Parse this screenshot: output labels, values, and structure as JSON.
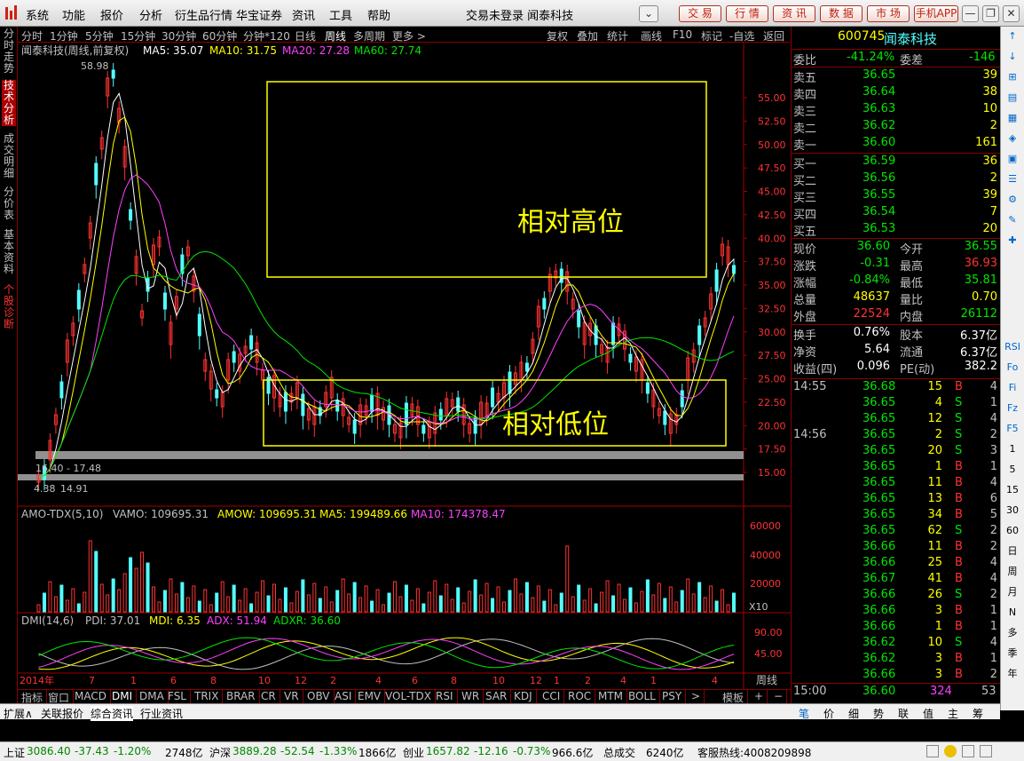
{
  "menu": {
    "items": [
      "系统",
      "功能",
      "报价",
      "分析",
      "衍生品行情",
      "华宝证券",
      "资讯",
      "工具",
      "帮助"
    ],
    "title": "交易未登录  闻泰科技",
    "buttons": [
      "交 易",
      "行 情",
      "资 讯",
      "数 据",
      "市 场",
      "手机APP"
    ]
  },
  "periods": {
    "items": [
      "分时",
      "1分钟",
      "5分钟",
      "15分钟",
      "30分钟",
      "60分钟",
      "分钟*120",
      "日线",
      "周线",
      "多周期",
      "更多 >"
    ],
    "right": [
      "复权",
      "叠加",
      "统计",
      "画线",
      "F10",
      "标记",
      "-自选",
      "返回"
    ]
  },
  "left_tabs": [
    "分时走势",
    "技术分析",
    "成交明细",
    "分价表",
    "基本资料",
    "个股诊断"
  ],
  "chart": {
    "stock_label": "闻泰科技(周线,前复权)",
    "ma": [
      {
        "label": "MA5: 35.07",
        "color": "#ffffff"
      },
      {
        "label": "MA10: 31.75",
        "color": "#ffff00"
      },
      {
        "label": "MA20: 27.28",
        "color": "#ff40ff"
      },
      {
        "label": "MA60: 27.74",
        "color": "#00e600"
      }
    ],
    "price_ticks": [
      "55.00",
      "52.50",
      "50.00",
      "47.50",
      "45.00",
      "42.50",
      "40.00",
      "37.50",
      "35.00",
      "32.50",
      "30.00",
      "27.50",
      "25.00",
      "22.50",
      "20.00",
      "17.50",
      "15.00"
    ],
    "high_label": "58.98",
    "low_label": "4.38",
    "low2": "14.91",
    "range_label": "16.40 - 17.48",
    "box_high": "相对高位",
    "box_low": "相对低位",
    "vol_label": "AMO-TDX(5,10)",
    "vol_items": [
      {
        "t": "VAMO: 109695.31",
        "c": "#c0c0c0"
      },
      {
        "t": "AMOW: 109695.31",
        "c": "#ffff00"
      },
      {
        "t": "MA5: 199489.66",
        "c": "#ffff00"
      },
      {
        "t": "MA10: 174378.47",
        "c": "#ff40ff"
      }
    ],
    "vol_ticks": [
      "60000",
      "40000",
      "20000"
    ],
    "vol_unit": "X10",
    "dmi_label": "DMI(14,6)",
    "dmi_items": [
      {
        "t": "PDI: 37.01",
        "c": "#c0c0c0"
      },
      {
        "t": "MDI: 6.35",
        "c": "#ffff00"
      },
      {
        "t": "ADX: 51.94",
        "c": "#ff40ff"
      },
      {
        "t": "ADXR: 36.60",
        "c": "#00e600"
      }
    ],
    "dmi_ticks": [
      "90.00",
      "45.00"
    ],
    "x_labels": [
      "2014年",
      "7",
      "1",
      "6",
      "8",
      "10",
      "12",
      "2",
      "4",
      "6",
      "8",
      "10",
      "12",
      "1",
      "2",
      "4",
      "1",
      "4"
    ],
    "period_label": "周线"
  },
  "bottom_tabs": [
    "指标",
    "窗口",
    "MACD",
    "DMI",
    "DMA",
    "FSL",
    "TRIX",
    "BRAR",
    "CR",
    "VR",
    "OBV",
    "ASI",
    "EMV",
    "VOL-TDX",
    "RSI",
    "WR",
    "SAR",
    "KDJ",
    "CCI",
    "ROC",
    "MTM",
    "BOLL",
    "PSY",
    ">",
    "模板",
    "+",
    "−"
  ],
  "info_tabs": [
    "扩展∧",
    "关联报价",
    "综合资讯",
    "行业资讯"
  ],
  "quote": {
    "code": "600745",
    "name": "闻泰科技",
    "weibi_label": "委比",
    "weibi": "-41.24%",
    "weicha_label": "委差",
    "weicha": "-146",
    "asks": [
      {
        "l": "卖五",
        "p": "36.65",
        "v": "39"
      },
      {
        "l": "卖四",
        "p": "36.64",
        "v": "38"
      },
      {
        "l": "卖三",
        "p": "36.63",
        "v": "10"
      },
      {
        "l": "卖二",
        "p": "36.62",
        "v": "2"
      },
      {
        "l": "卖一",
        "p": "36.60",
        "v": "161"
      }
    ],
    "bids": [
      {
        "l": "买一",
        "p": "36.59",
        "v": "36"
      },
      {
        "l": "买二",
        "p": "36.56",
        "v": "2"
      },
      {
        "l": "买三",
        "p": "36.55",
        "v": "39"
      },
      {
        "l": "买四",
        "p": "36.54",
        "v": "7"
      },
      {
        "l": "买五",
        "p": "36.53",
        "v": "20"
      }
    ],
    "stats": [
      {
        "l1": "现价",
        "v1": "36.60",
        "c1": "green",
        "l2": "今开",
        "v2": "36.55",
        "c2": "green"
      },
      {
        "l1": "涨跌",
        "v1": "-0.31",
        "c1": "green",
        "l2": "最高",
        "v2": "36.93",
        "c2": "red"
      },
      {
        "l1": "涨幅",
        "v1": "-0.84%",
        "c1": "green",
        "l2": "最低",
        "v2": "35.81",
        "c2": "green"
      },
      {
        "l1": "总量",
        "v1": "48637",
        "c1": "yellow",
        "l2": "量比",
        "v2": "0.70",
        "c2": "yellow"
      },
      {
        "l1": "外盘",
        "v1": "22524",
        "c1": "red",
        "l2": "内盘",
        "v2": "26112",
        "c2": "green"
      }
    ],
    "stats2": [
      {
        "l1": "换手",
        "v1": "0.76%",
        "l2": "股本",
        "v2": "6.37亿"
      },
      {
        "l1": "净资",
        "v1": "5.64",
        "l2": "流通",
        "v2": "6.37亿"
      },
      {
        "l1": "收益(四)",
        "v1": "0.096",
        "l2": "PE(动)",
        "v2": "382.2"
      }
    ],
    "ticks": [
      {
        "t": "14:55",
        "p": "36.68",
        "v": "15",
        "s": "B",
        "n": "4"
      },
      {
        "t": "",
        "p": "36.65",
        "v": "4",
        "s": "S",
        "n": "1"
      },
      {
        "t": "",
        "p": "36.65",
        "v": "12",
        "s": "S",
        "n": "4"
      },
      {
        "t": "14:56",
        "p": "36.65",
        "v": "2",
        "s": "S",
        "n": "2"
      },
      {
        "t": "",
        "p": "36.65",
        "v": "20",
        "s": "S",
        "n": "3"
      },
      {
        "t": "",
        "p": "36.65",
        "v": "1",
        "s": "B",
        "n": "1"
      },
      {
        "t": "",
        "p": "36.65",
        "v": "11",
        "s": "B",
        "n": "4"
      },
      {
        "t": "",
        "p": "36.65",
        "v": "13",
        "s": "B",
        "n": "6"
      },
      {
        "t": "",
        "p": "36.65",
        "v": "34",
        "s": "B",
        "n": "5"
      },
      {
        "t": "",
        "p": "36.65",
        "v": "62",
        "s": "S",
        "n": "2"
      },
      {
        "t": "",
        "p": "36.66",
        "v": "11",
        "s": "B",
        "n": "2"
      },
      {
        "t": "",
        "p": "36.66",
        "v": "25",
        "s": "B",
        "n": "4"
      },
      {
        "t": "",
        "p": "36.67",
        "v": "41",
        "s": "B",
        "n": "4"
      },
      {
        "t": "",
        "p": "36.66",
        "v": "26",
        "s": "S",
        "n": "2"
      },
      {
        "t": "",
        "p": "36.66",
        "v": "3",
        "s": "B",
        "n": "1"
      },
      {
        "t": "",
        "p": "36.66",
        "v": "1",
        "s": "B",
        "n": "1"
      },
      {
        "t": "",
        "p": "36.62",
        "v": "10",
        "s": "S",
        "n": "4"
      },
      {
        "t": "",
        "p": "36.62",
        "v": "3",
        "s": "B",
        "n": "1"
      },
      {
        "t": "",
        "p": "36.66",
        "v": "3",
        "s": "B",
        "n": "2"
      }
    ],
    "last_tick": {
      "t": "15:00",
      "p": "36.60",
      "v": "324",
      "n": "53"
    },
    "tabs": [
      "笔",
      "价",
      "细",
      "势",
      "联",
      "值",
      "主",
      "筹"
    ]
  },
  "tools": [
    "RSI",
    "Fo",
    "Fi",
    "Fz",
    "F5",
    "1",
    "5",
    "15",
    "30",
    "60",
    "日",
    "周",
    "月",
    "N",
    "多",
    "季",
    "年"
  ],
  "status": {
    "sh_label": "上证",
    "sh": "3086.40",
    "sh_chg": "-37.43",
    "sh_pct": "-1.20%",
    "sh_amt": "2748亿",
    "sz_label": "沪深",
    "sz": "3889.28",
    "sz_chg": "-52.54",
    "sz_pct": "-1.33%",
    "sz_amt": "1866亿",
    "cy_label": "创业",
    "cy": "1657.82",
    "cy_chg": "-12.16",
    "cy_pct": "-0.73%",
    "cy_amt": "966.6亿",
    "total_label": "总成交",
    "total": "6240亿",
    "hotline": "客服热线:4008209898"
  }
}
